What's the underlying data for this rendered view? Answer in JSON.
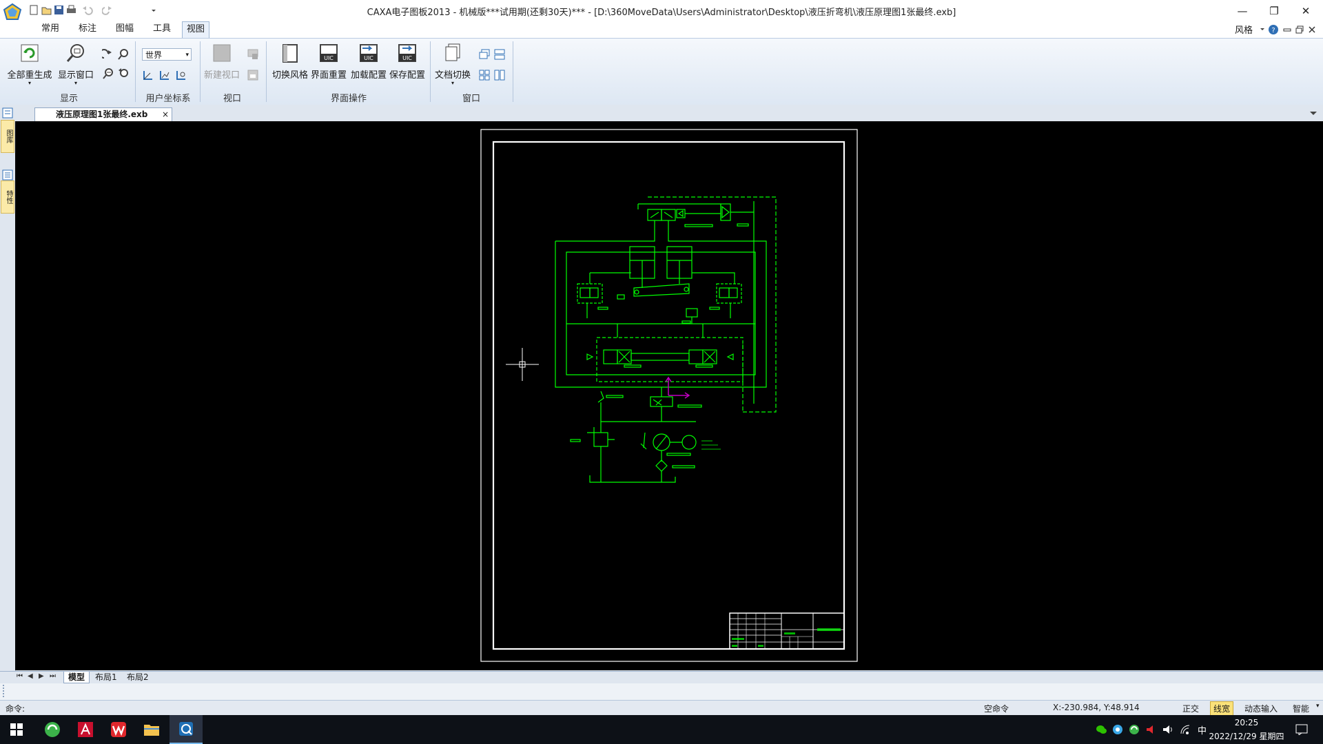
{
  "window": {
    "title": "CAXA电子图板2013 - 机械版***试用期(还剩30天)*** - [D:\\360MoveData\\Users\\Administrator\\Desktop\\液压折弯机\\液压原理图1张最终.exb]",
    "controls": {
      "minimize": "—",
      "restore": "❐",
      "close": "✕"
    }
  },
  "ribbon": {
    "tabs": [
      "常用",
      "标注",
      "图幅",
      "工具",
      "视图"
    ],
    "active_tab": "视图",
    "style_label": "风格",
    "groups": {
      "display": {
        "label": "显示",
        "regen_all": "全部重生成",
        "show_window": "显示窗口"
      },
      "ucs": {
        "label": "用户坐标系",
        "coord_select": "世界"
      },
      "viewport": {
        "label": "视口",
        "new_viewport": "新建视口"
      },
      "ui_ops": {
        "label": "界面操作",
        "switch_style": "切换风格",
        "reset_ui": "界面重置",
        "load_config": "加载配置",
        "save_config": "保存配置"
      },
      "window": {
        "label": "窗口",
        "doc_switch": "文档切换"
      }
    }
  },
  "document": {
    "tab_title": "液压原理图1张最终.exb",
    "close": "×"
  },
  "left_dock": [
    "图库",
    "特性"
  ],
  "layout_tabs": [
    "模型",
    "布局1",
    "布局2"
  ],
  "command": {
    "prompt": "命令:"
  },
  "status": {
    "command_state": "空命令",
    "coords": "X:-230.984, Y:48.914",
    "toggles": [
      "正交",
      "线宽",
      "动态输入",
      "智能"
    ]
  },
  "taskbar": {
    "ime": "中",
    "time": "20:25",
    "date": "2022/12/29 星期四"
  },
  "colors": {
    "drawing_green": "#00ff00",
    "magenta": "#c000c0",
    "canvas_bg": "#000000"
  }
}
